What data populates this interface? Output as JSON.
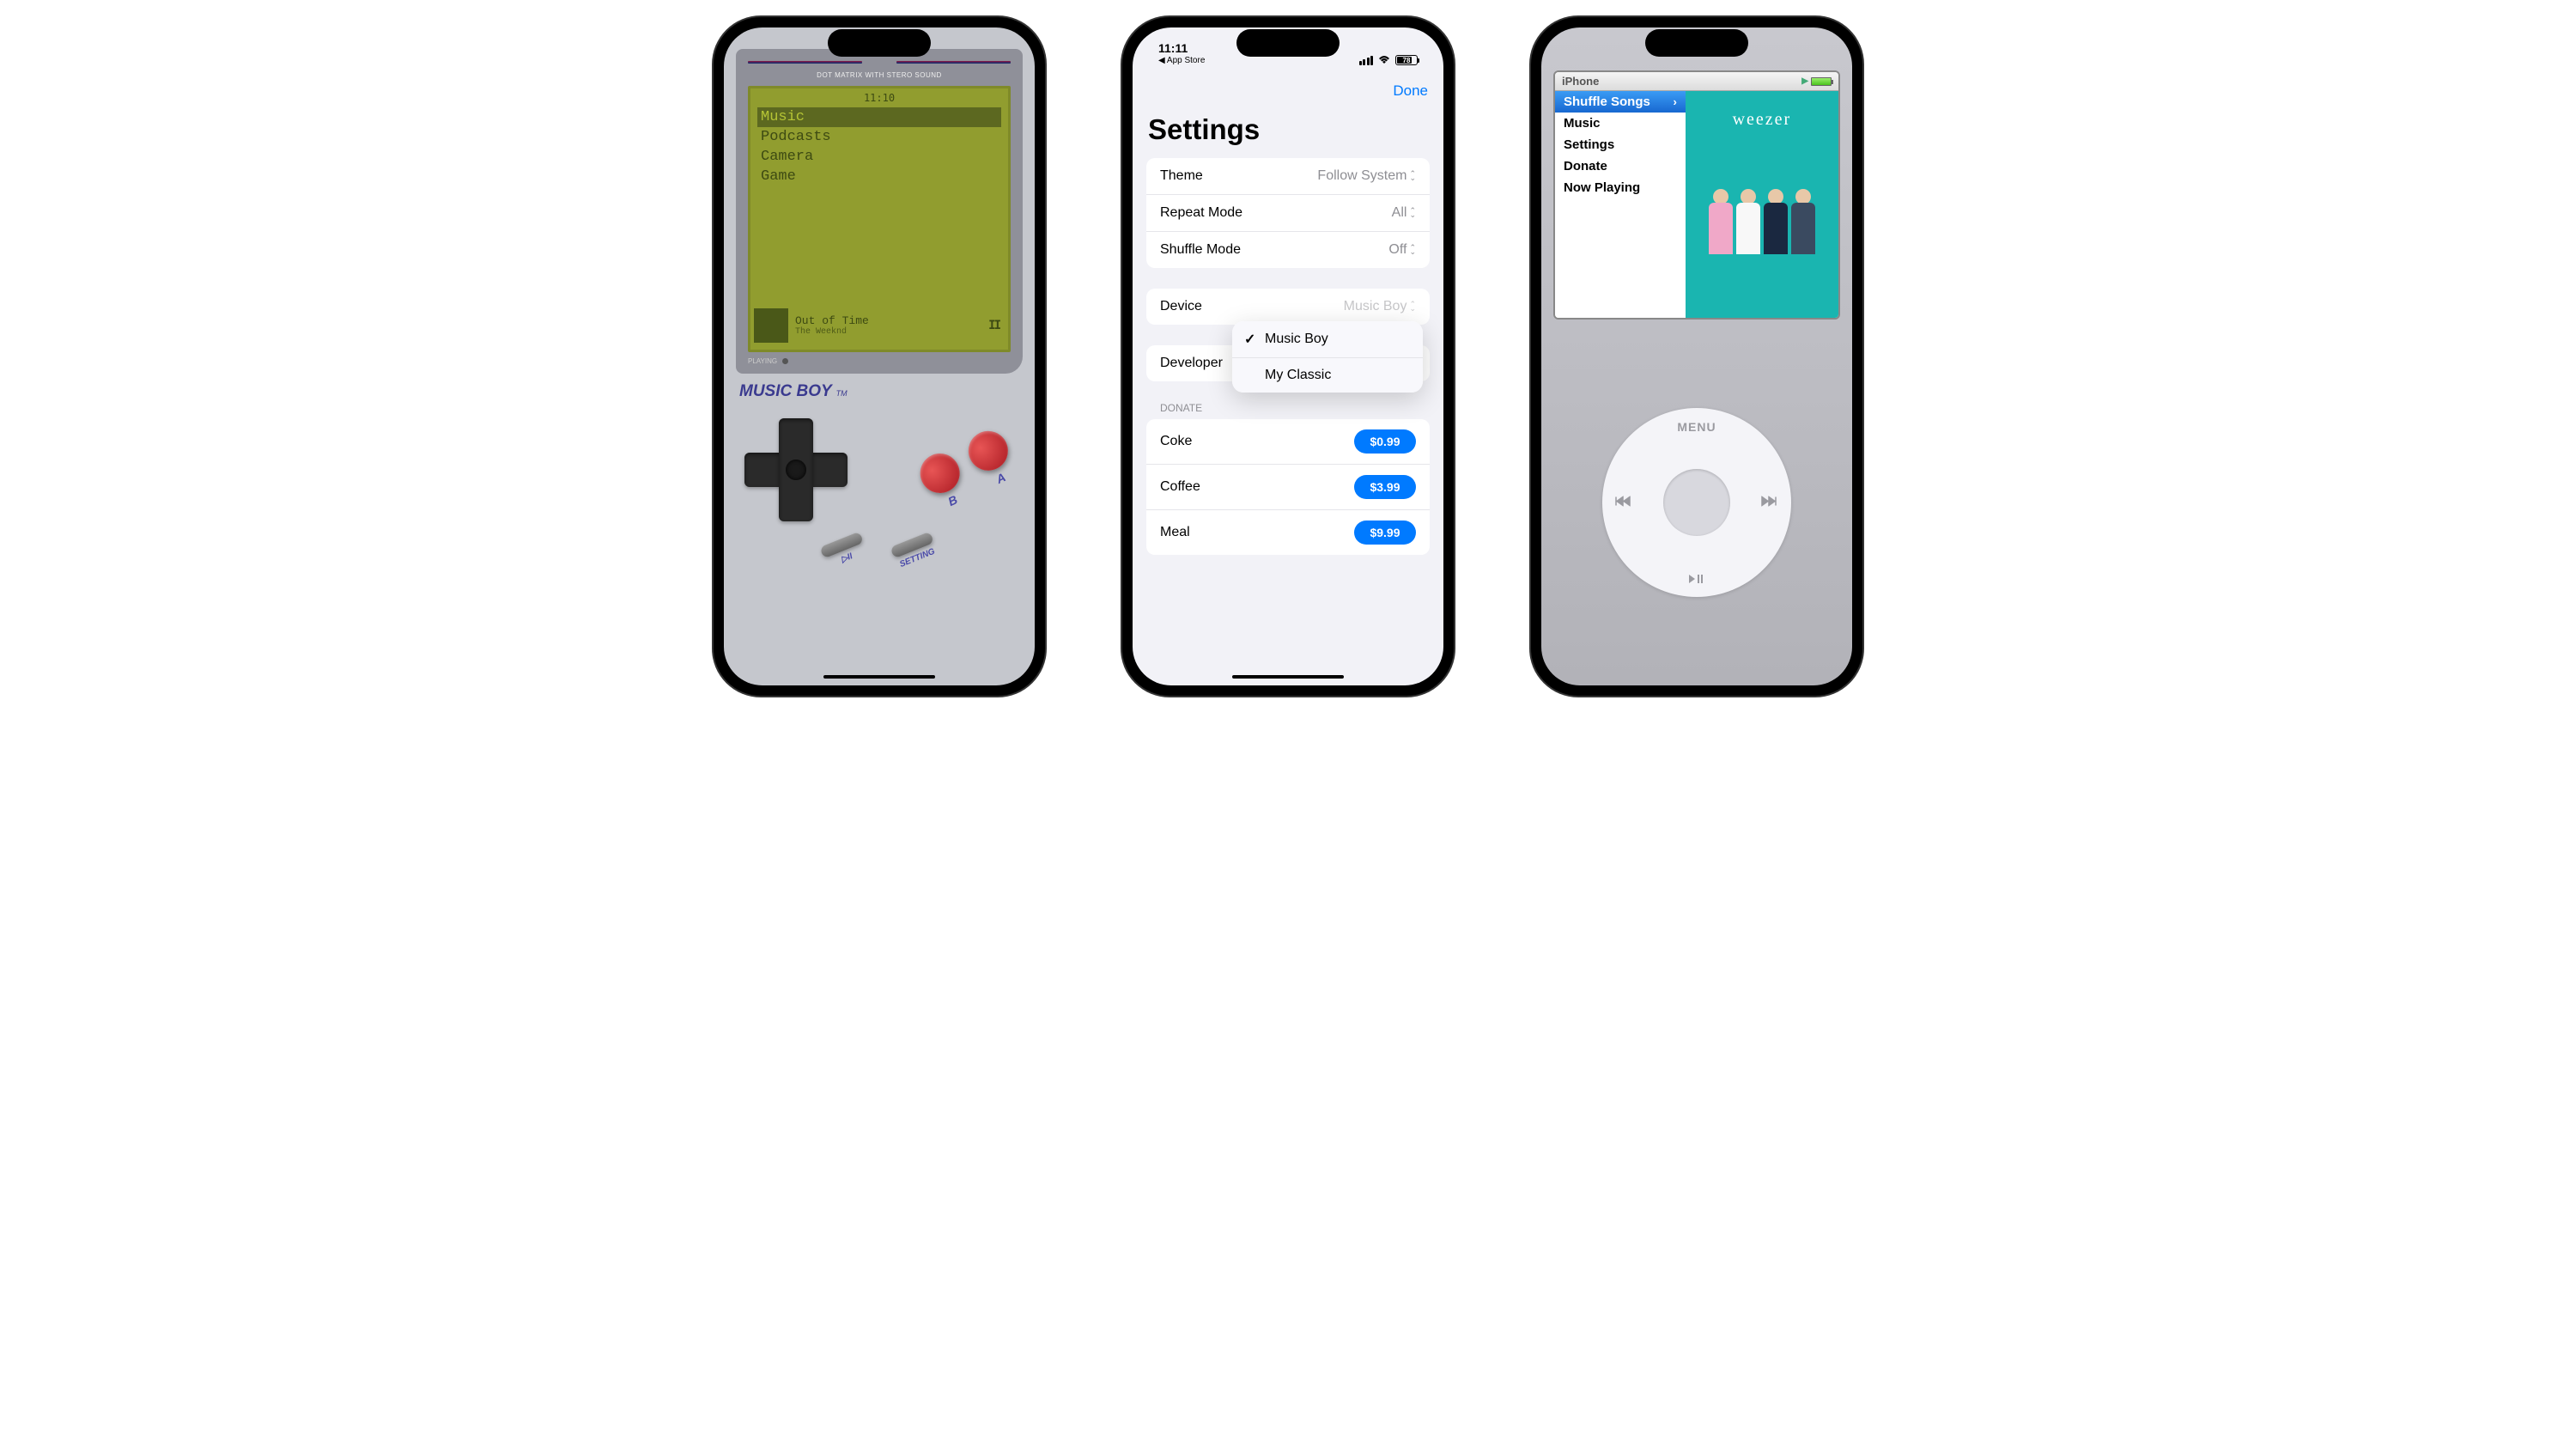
{
  "musicboy": {
    "toptext": "DOT MATRIX WITH STERO SOUND",
    "clock": "11:10",
    "menu": [
      "Music",
      "Podcasts",
      "Camera",
      "Game"
    ],
    "selected_index": 0,
    "now_playing": {
      "title": "Out of Time",
      "artist": "The Weeknd"
    },
    "playing_label": "PLAYING",
    "brand": "MUSIC BOY",
    "tm": "TM",
    "btn_a": "A",
    "btn_b": "B",
    "btn_play": "▷II",
    "btn_setting": "SETTING"
  },
  "settings": {
    "status_time": "11:11",
    "status_back": "◀ App Store",
    "battery_pct": "78",
    "done": "Done",
    "title": "Settings",
    "rows": {
      "theme": {
        "label": "Theme",
        "value": "Follow System"
      },
      "repeat": {
        "label": "Repeat Mode",
        "value": "All"
      },
      "shuffle": {
        "label": "Shuffle Mode",
        "value": "Off"
      },
      "device": {
        "label": "Device",
        "value": "Music Boy"
      },
      "developer": {
        "label": "Developer"
      }
    },
    "device_options": [
      "Music Boy",
      "My Classic"
    ],
    "device_selected_index": 0,
    "donate_header": "Donate",
    "donate": [
      {
        "label": "Coke",
        "price": "$0.99"
      },
      {
        "label": "Coffee",
        "price": "$3.99"
      },
      {
        "label": "Meal",
        "price": "$9.99"
      }
    ]
  },
  "ipod": {
    "status_title": "iPhone",
    "menu": [
      "Shuffle Songs",
      "Music",
      "Settings",
      "Donate",
      "Now Playing"
    ],
    "selected_index": 0,
    "artist": "weezer",
    "wheel": {
      "menu": "MENU",
      "prev": "◀◀",
      "next": "▶▶",
      "playpause": "▶II"
    }
  }
}
